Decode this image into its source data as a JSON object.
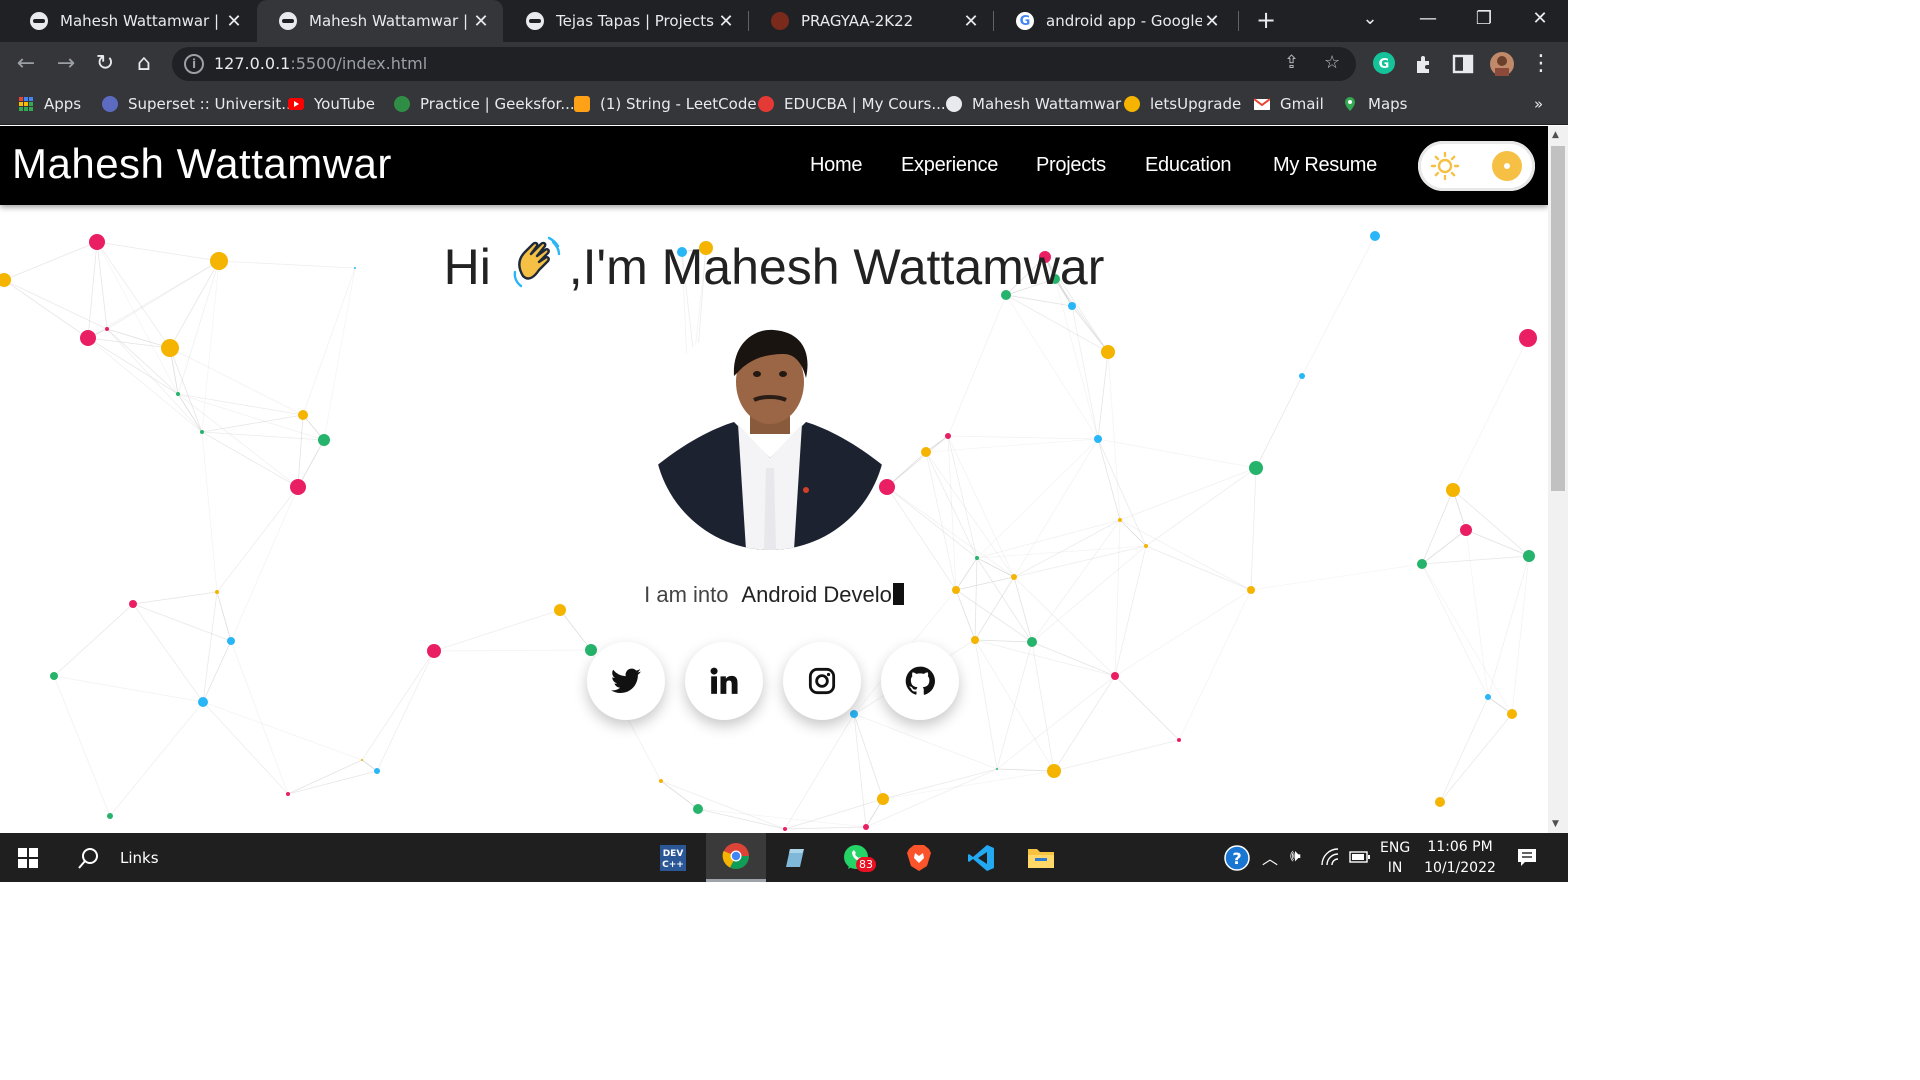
{
  "browser": {
    "tabs": [
      {
        "title": "Mahesh Wattamwar | Projects",
        "active": false
      },
      {
        "title": "Mahesh Wattamwar | Home",
        "active": true
      },
      {
        "title": "Tejas Tapas | Projects",
        "active": false
      },
      {
        "title": "PRAGYAA-2K22",
        "active": false
      },
      {
        "title": "android app - Google Search",
        "active": false
      }
    ],
    "new_tab_label": "+",
    "url_host": "127.0.0.1",
    "url_rest": ":5500/index.html",
    "bookmarks": [
      {
        "label": "Apps",
        "icon": "apps-grid-icon",
        "color": "#4285f4"
      },
      {
        "label": "Superset :: Universit...",
        "icon": "superset-icon",
        "color": "#5c6bc0"
      },
      {
        "label": "YouTube",
        "icon": "youtube-icon",
        "color": "#ff0000"
      },
      {
        "label": "Practice | Geeksfor...",
        "icon": "geeksforgeeks-icon",
        "color": "#2f8d46"
      },
      {
        "label": "(1) String - LeetCode",
        "icon": "leetcode-icon",
        "color": "#ffa116"
      },
      {
        "label": "EDUCBA | My Cours...",
        "icon": "educba-icon",
        "color": "#e53935"
      },
      {
        "label": "Mahesh Wattamwar",
        "icon": "globe-icon",
        "color": "#e8eaed"
      },
      {
        "label": "letsUpgrade",
        "icon": "letsupgrade-icon",
        "color": "#f4b400"
      },
      {
        "label": "Gmail",
        "icon": "gmail-icon",
        "color": "#ea4335"
      },
      {
        "label": "Maps",
        "icon": "maps-icon",
        "color": "#34a853"
      }
    ],
    "bookmarks_overflow": "»"
  },
  "site": {
    "brand": "Mahesh Wattamwar",
    "menu": [
      "Home",
      "Experience",
      "Projects",
      "Education",
      "My Resume"
    ],
    "greeting_hi": "Hi",
    "greeting_im": ",I'm",
    "greeting_name": "Mahesh Wattamwar",
    "typing_lead": "I am into",
    "typing_text": "Android Develo",
    "social": [
      "twitter-icon",
      "linkedin-icon",
      "instagram-icon",
      "github-icon"
    ],
    "accent": "#f6c044",
    "particle_colors": [
      "#e91e63",
      "#f4b400",
      "#29b6f6",
      "#26b36b"
    ]
  },
  "taskbar": {
    "search_label": "Links",
    "language_top": "ENG",
    "language_bottom": "IN",
    "time": "11:06 PM",
    "date": "10/1/2022",
    "whatsapp_badge": "83"
  }
}
